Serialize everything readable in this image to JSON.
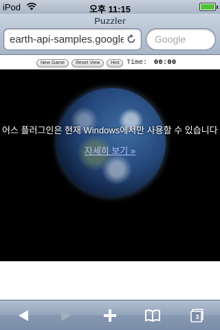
{
  "status_bar": {
    "carrier": "iPod",
    "time": "오후 11:15"
  },
  "browser": {
    "page_title": "Puzzler",
    "url": "earth-api-samples.googlecode.com",
    "search_placeholder": "Google"
  },
  "controls": {
    "new_game": "New Game",
    "reset_view": "Reset View",
    "hint": "Hint",
    "time_label": "Time:",
    "time_value": "00:00"
  },
  "earth": {
    "message": "어스 플러그인은 현재 Windows에서만 사용할 수 있습니다",
    "more_link": "자세히 보기 »"
  },
  "toolbar": {
    "open_pages_count": "3"
  },
  "icons": [
    "wifi-icon",
    "battery-icon",
    "reload-icon",
    "back-icon",
    "forward-icon",
    "add-icon",
    "bookmarks-icon",
    "pages-icon"
  ]
}
